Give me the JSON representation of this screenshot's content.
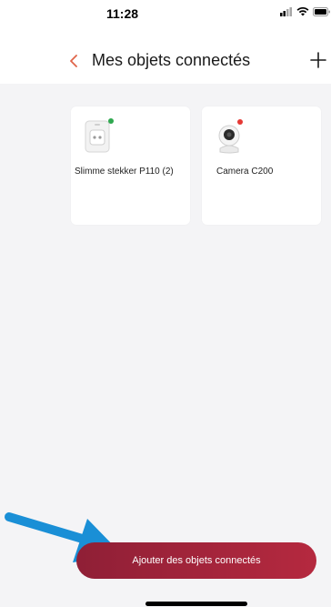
{
  "status_bar": {
    "time": "11:28",
    "icons": [
      "signal-icon",
      "wifi-icon",
      "battery-icon"
    ]
  },
  "header": {
    "back_icon": "chevron-left-icon",
    "title": "Mes objets connectés",
    "add_icon": "plus-icon"
  },
  "devices": [
    {
      "name": "Slimme stekker P110 (2)",
      "icon": "smart-plug-icon",
      "status_color": "#2fa84f"
    },
    {
      "name": "Camera C200",
      "icon": "camera-icon",
      "status_color": "#e53935"
    }
  ],
  "footer": {
    "add_devices_label": "Ajouter des objets connectés"
  },
  "colors": {
    "accent": "#e0654a",
    "button": "#a3223a",
    "annotation": "#1a8fd6"
  }
}
